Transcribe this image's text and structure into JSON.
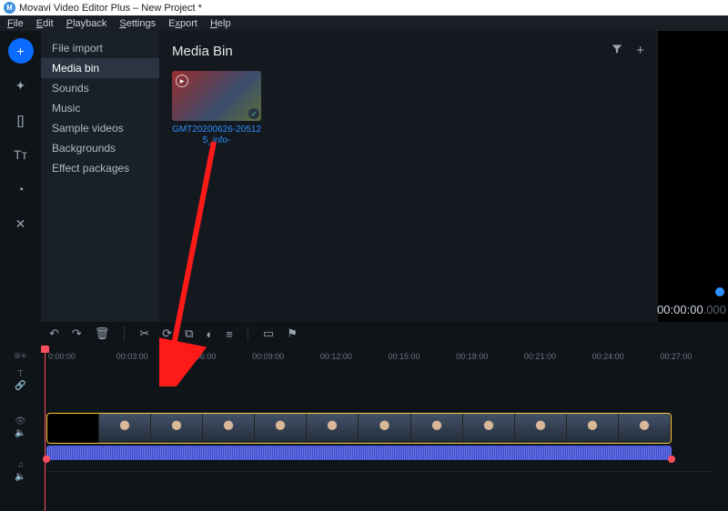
{
  "window": {
    "title": "Movavi Video Editor Plus – New Project *"
  },
  "menu": [
    "File",
    "Edit",
    "Playback",
    "Settings",
    "Export",
    "Help"
  ],
  "tools": {
    "add": "+",
    "fx": "✦",
    "split": "[]",
    "text": "Tᴛ",
    "trans": "◔",
    "more": "✕"
  },
  "sidebar": {
    "items": [
      "File import",
      "Media bin",
      "Sounds",
      "Music",
      "Sample videos",
      "Backgrounds",
      "Effect packages"
    ],
    "selected": 1
  },
  "bin": {
    "title": "Media Bin",
    "filter_icon": "▼",
    "add_icon": "+",
    "clip_name": "GMT20200626-205125_info-"
  },
  "preview": {
    "time_main": "00:00:00",
    "time_ms": ".000"
  },
  "toolbar": {
    "undo": "↶",
    "redo": "↷",
    "delete": "🗑",
    "cut": "✂",
    "rotate": "⟳",
    "crop": "⧉",
    "color": "◐",
    "adjust": "≡",
    "record": "▭",
    "marker": "⚑"
  },
  "ruler": [
    "0:00:00",
    "00:03:00",
    "00:06:00",
    "00:09:00",
    "00:12:00",
    "00:15:00",
    "00:18:00",
    "00:21:00",
    "00:24:00",
    "00:27:00"
  ],
  "track_rail": {
    "add": "≡+",
    "text": "T",
    "link": "🔗",
    "eye": "👁",
    "vol": "🔈",
    "note": "♫"
  }
}
